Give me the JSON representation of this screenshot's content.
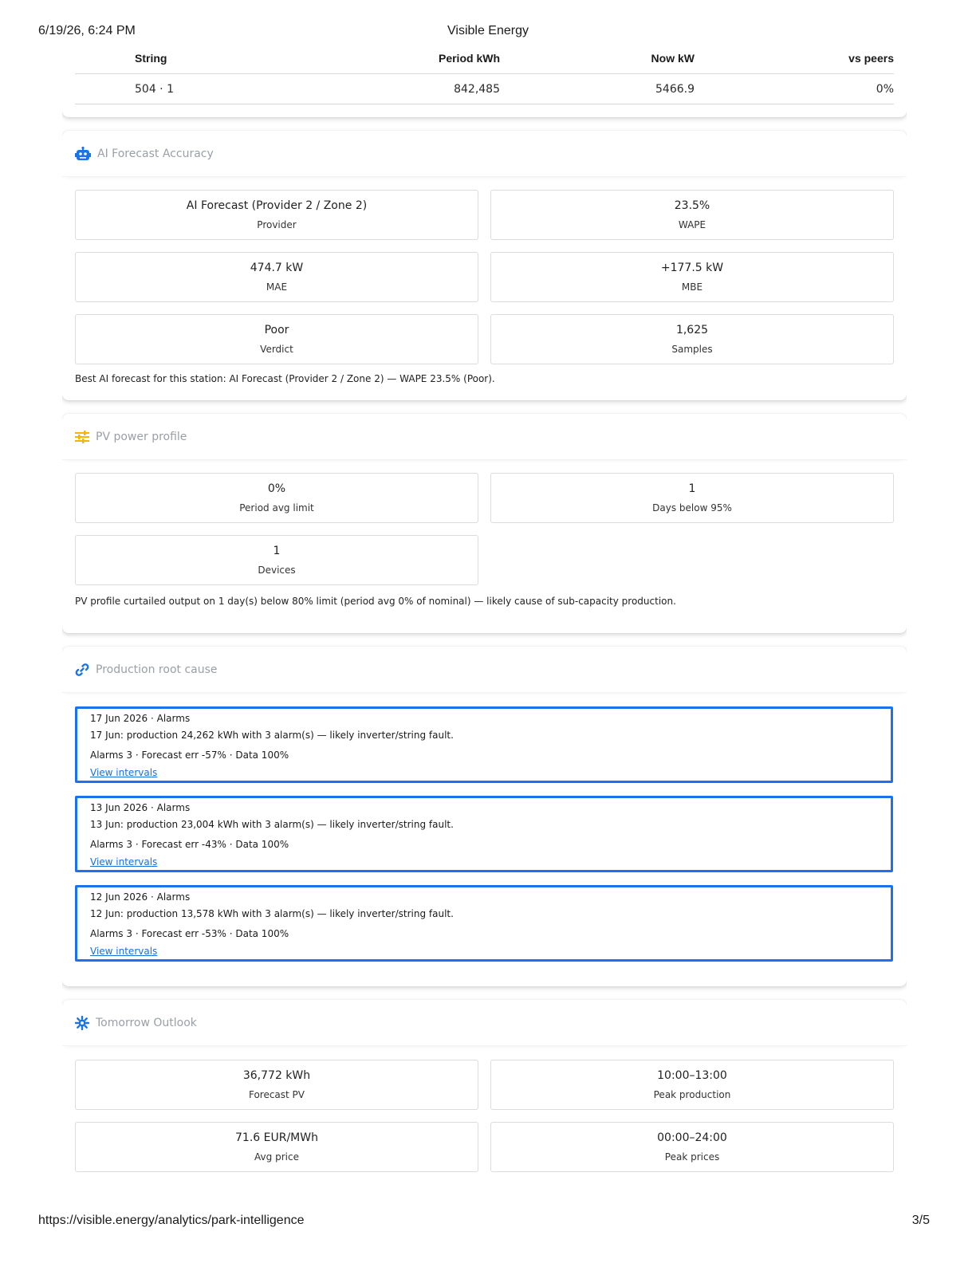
{
  "print": {
    "datetime": "6/19/26, 6:24 PM",
    "title": "Visible Energy",
    "url": "https://visible.energy/analytics/park-intelligence",
    "page": "3/5"
  },
  "strings_table": {
    "headers": [
      "String",
      "Period kWh",
      "Now kW",
      "vs peers"
    ],
    "rows": [
      [
        "504 · 1",
        "842,485",
        "5466.9",
        "0%"
      ]
    ]
  },
  "ai_forecast": {
    "title": "AI Forecast Accuracy",
    "icon": "robot-icon",
    "stats": [
      {
        "value": "AI Forecast (Provider 2 / Zone 2)",
        "label": "Provider"
      },
      {
        "value": "23.5%",
        "label": "WAPE"
      },
      {
        "value": "474.7 kW",
        "label": "MAE"
      },
      {
        "value": "+177.5 kW",
        "label": "MBE"
      },
      {
        "value": "Poor",
        "label": "Verdict"
      },
      {
        "value": "1,625",
        "label": "Samples"
      }
    ],
    "note": "Best AI forecast for this station: AI Forecast (Provider 2 / Zone 2) — WAPE 23.5% (Poor)."
  },
  "pv_profile": {
    "title": "PV power profile",
    "icon": "sliders-icon",
    "stats": [
      {
        "value": "0%",
        "label": "Period avg limit"
      },
      {
        "value": "1",
        "label": "Days below 95%"
      },
      {
        "value": "1",
        "label": "Devices"
      }
    ],
    "note": "PV profile curtailed output on 1 day(s) below 80% limit (period avg 0% of nominal) — likely cause of sub-capacity production."
  },
  "root_cause": {
    "title": "Production root cause",
    "icon": "link-icon",
    "items": [
      {
        "heading": "17 Jun 2026 · Alarms",
        "summary": "17 Jun: production 24,262 kWh with 3 alarm(s) — likely inverter/string fault.",
        "metrics": "Alarms 3 · Forecast err -57% · Data 100%",
        "link": "View intervals"
      },
      {
        "heading": "13 Jun 2026 · Alarms",
        "summary": "13 Jun: production 23,004 kWh with 3 alarm(s) — likely inverter/string fault.",
        "metrics": "Alarms 3 · Forecast err -43% · Data 100%",
        "link": "View intervals"
      },
      {
        "heading": "12 Jun 2026 · Alarms",
        "summary": "12 Jun: production 13,578 kWh with 3 alarm(s) — likely inverter/string fault.",
        "metrics": "Alarms 3 · Forecast err -53% · Data 100%",
        "link": "View intervals"
      }
    ]
  },
  "tomorrow": {
    "title": "Tomorrow Outlook",
    "icon": "sun-gear-icon",
    "stats": [
      {
        "value": "36,772 kWh",
        "label": "Forecast PV"
      },
      {
        "value": "10:00–13:00",
        "label": "Peak production"
      },
      {
        "value": "71.6 EUR/MWh",
        "label": "Avg price"
      },
      {
        "value": "00:00–24:00",
        "label": "Peak prices"
      }
    ]
  },
  "colors": {
    "accent": "#1a73e8",
    "pv_icon": "#f5b400",
    "muted": "#9a9fa6"
  }
}
